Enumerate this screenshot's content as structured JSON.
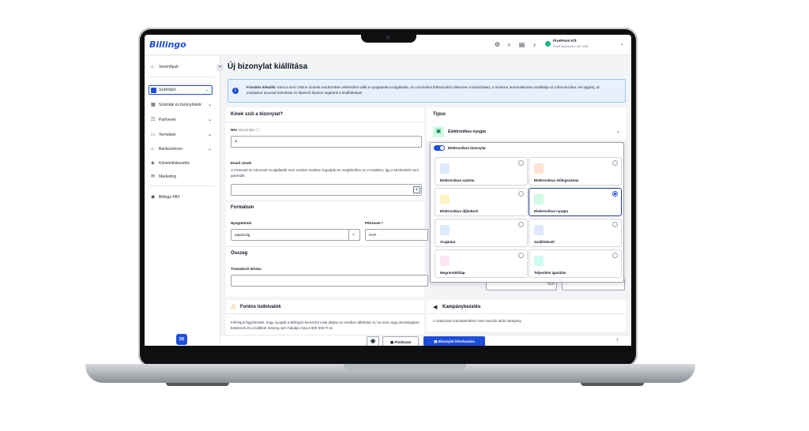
{
  "header": {
    "logo": "Billingo",
    "company_name": "PixelPoint Kft.",
    "company_id": "Profil azonosító: 187-618"
  },
  "sidebar": {
    "dashboard": "Vezérlőpult",
    "module_select": "Számlázó",
    "items": [
      {
        "label": "Számlák és bizonyítatok"
      },
      {
        "label": "Partnerek"
      },
      {
        "label": "Termékek"
      },
      {
        "label": "Bankszinkron"
      },
      {
        "label": "Követeléskezelés"
      },
      {
        "label": "Marketing"
      }
    ],
    "pay": "Billingo PAY"
  },
  "page": {
    "title": "Új bizonylat kiállítása"
  },
  "banner": {
    "bold": "Frissítés érkezik!",
    "text": " Amint a NAV Online Számla rendszerben elérhetővé válik a nyugtaadat-szolgáltatás, és a technikai felhasználót sikeresen módosítottad, a rendszer automatikusan továbbítja az információkat. Ne aggódj, az induláskor azonnal értesítünk és lépésről lépésre segítünk a beállításban!"
  },
  "recipient": {
    "title": "Kinek szól a bizonylat?",
    "name_label": "Név",
    "name_optional": "Opcionális",
    "email_label": "Email címek",
    "email_help": "A Freemail és Citromail szolgáltatók nem minden esetben fogadják be megfelelően az e-maileket, így a kézbesítés nem garantált."
  },
  "format": {
    "title": "Formátum",
    "block_label": "Nyugtatömb",
    "block_value": "adatszolg",
    "currency_label": "Pénznem *",
    "currency_value": "HUF"
  },
  "amount": {
    "title": "Összeg",
    "desc_label": "Tranzakció leírása",
    "currency": "HUF",
    "dash": "-"
  },
  "important": {
    "title": "Fontos tudnivalók",
    "text": "Felhívjuk figyelmedet, hogy nyugtát a Billingón keresztül csak abban az esetben állíthatsz ki, ha nem vagy pénztárgépre kötelezett és a kiállított összeg nem haladja meg a 900 000 Ft-ot."
  },
  "type": {
    "title": "Típus",
    "selected": "Elektronikus nyugta",
    "toggle_label": "Elektronikus bizonylat",
    "tiles": [
      {
        "label": "Elektronikus számla",
        "color": "#dbeafe",
        "selected": false
      },
      {
        "label": "Elektronikus előlegszámla",
        "color": "#fde2d3",
        "selected": false
      },
      {
        "label": "Elektronikus díjbekérő",
        "color": "#fef3c7",
        "selected": false
      },
      {
        "label": "Elektronikus nyugta",
        "color": "#d1fae5",
        "selected": true
      },
      {
        "label": "Árajánlat",
        "color": "#dbeafe",
        "selected": false
      },
      {
        "label": "Szállítólevél",
        "color": "#e0e7ff",
        "selected": false
      },
      {
        "label": "Megrendelőlap",
        "color": "#fce7f3",
        "selected": false
      },
      {
        "label": "Teljesítési igazolás",
        "color": "#ccfbf1",
        "selected": false
      }
    ]
  },
  "campaign": {
    "title": "Kampánykezelés",
    "text": "A választott számlatömbhöz nem tartozik aktív kampány."
  },
  "actions": {
    "draft": "Piszkozat",
    "create": "Bizonylat létrehozása"
  },
  "colors": {
    "accent": "#1d4ed8",
    "selected_border": "#1e3a8a"
  }
}
